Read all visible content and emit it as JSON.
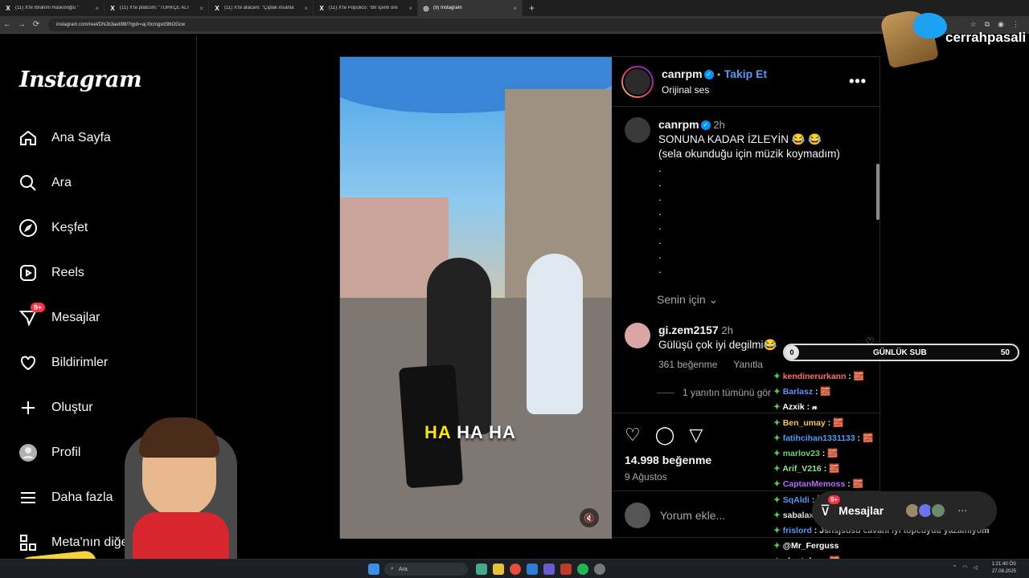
{
  "browser": {
    "tabs": [
      {
        "icon": "X",
        "title": "(11) X'te İbrahim Haskoloğlu \""
      },
      {
        "icon": "X",
        "title": "(11) X'te platcom: \"TÜRKÇE ALT"
      },
      {
        "icon": "X",
        "title": "(11) X'te afacanı: \"Çıplak insanla"
      },
      {
        "icon": "X",
        "title": "(11) X'te Populico: \"Bir içerik üre"
      },
      {
        "icon": "◎",
        "title": "(9) Instagram"
      }
    ],
    "new_tab": "+",
    "url": "instagram.com/reel/DNJb3aeti98/?igsh=aj l0cmgxd3l6OGcw"
  },
  "sidebar": {
    "logo": "Instagram",
    "items": [
      {
        "label": "Ana Sayfa",
        "icon": "home-icon"
      },
      {
        "label": "Ara",
        "icon": "search-icon"
      },
      {
        "label": "Keşfet",
        "icon": "compass-icon"
      },
      {
        "label": "Reels",
        "icon": "reels-icon"
      },
      {
        "label": "Mesajlar",
        "icon": "messenger-icon",
        "badge": "9+"
      },
      {
        "label": "Bildirimler",
        "icon": "heart-icon"
      },
      {
        "label": "Oluştur",
        "icon": "plus-icon"
      },
      {
        "label": "Profil",
        "icon": "profile-icon"
      },
      {
        "label": "Daha fazla",
        "icon": "menu-icon"
      },
      {
        "label": "Meta'nın diğe",
        "icon": "meta-apps-icon"
      }
    ]
  },
  "post": {
    "username": "canrpm",
    "separator": "•",
    "follow": "Takip Et",
    "audio": "Orijinal ses",
    "more": "•••",
    "video_caption_hl": "HA",
    "video_caption_rest": "HA HA",
    "caption": {
      "username": "canrpm",
      "time": "2h",
      "line1": "SONUNA KADAR İZLEYİN 😂 😂",
      "line2": "(sela okunduğu için müzik koymadım)",
      "dots": [
        ".",
        ".",
        ".",
        ".",
        ".",
        ".",
        ".",
        "."
      ]
    },
    "for_you": "Senin için",
    "comment": {
      "username": "gi.zem2157",
      "time": "2h",
      "text": "Gülüşü çok iyi degilmi😂",
      "likes": "361 beğenme",
      "reply": "Yanıtla",
      "view_replies": "1 yanıtın tümünü gör"
    },
    "likes": "14.998 beğenme",
    "date": "9 Ağustos",
    "add_comment_placeholder": "Yorum ekle..."
  },
  "overlay": {
    "handle": "cerrahpasali",
    "sub_bar": {
      "current": "0",
      "label": "GÜNLÜK SUB",
      "goal": "50"
    },
    "chat": [
      {
        "user": "kendinerurkann",
        "sep": " :",
        "text": " 🧱",
        "color": "#ff6b6b"
      },
      {
        "user": "Barlasz",
        "sep": " :",
        "text": " 🧱",
        "color": "#6b8cff"
      },
      {
        "user": "Azxik",
        "sep": " :",
        "text": " 𝓃",
        "color": "#ffffff"
      },
      {
        "user": "Ben_umay",
        "sep": " :",
        "text": " 🧱",
        "color": "#f6c744"
      },
      {
        "user": "fatihcihan1331133",
        "sep": " :",
        "text": " 🧱",
        "color": "#4a9df8"
      },
      {
        "user": "marlov23",
        "sep": " :",
        "text": " 🧱",
        "color": "#6ad46a"
      },
      {
        "user": "Arif_V216",
        "sep": " :",
        "text": " 🧱",
        "color": "#8fe38f"
      },
      {
        "user": "CaptanMemoss",
        "sep": " :",
        "text": " 🧱",
        "color": "#b46bff"
      },
      {
        "user": "SqAldi",
        "sep": " :",
        "text": " 🧱",
        "color": "#4a9df8"
      },
      {
        "user": "sabalaxy",
        "sep": " :",
        "text": " 🧱",
        "color": "#e0e0e0"
      },
      {
        "user": "frislord",
        "sep": " :",
        "text": " Jshsjsusu cavani iyi topcuydu yazamiyom",
        "color": "#4a9df8"
      },
      {
        "user": "@Mr_Ferguss",
        "sep": "",
        "text": "",
        "color": "#ffffff"
      },
      {
        "user": "ukurtolog",
        "sep": " :",
        "text": " 🧱",
        "color": "#ffffff"
      }
    ],
    "messages_bar": {
      "label": "Mesajlar",
      "badge": "9+"
    }
  },
  "taskbar": {
    "search": "Ara",
    "time": "1:21:40 ÖS",
    "date": "27.08.2025"
  },
  "colors": {
    "accent": "#0095f6",
    "badge": "#ff3040",
    "follow": "#4a9df8"
  }
}
